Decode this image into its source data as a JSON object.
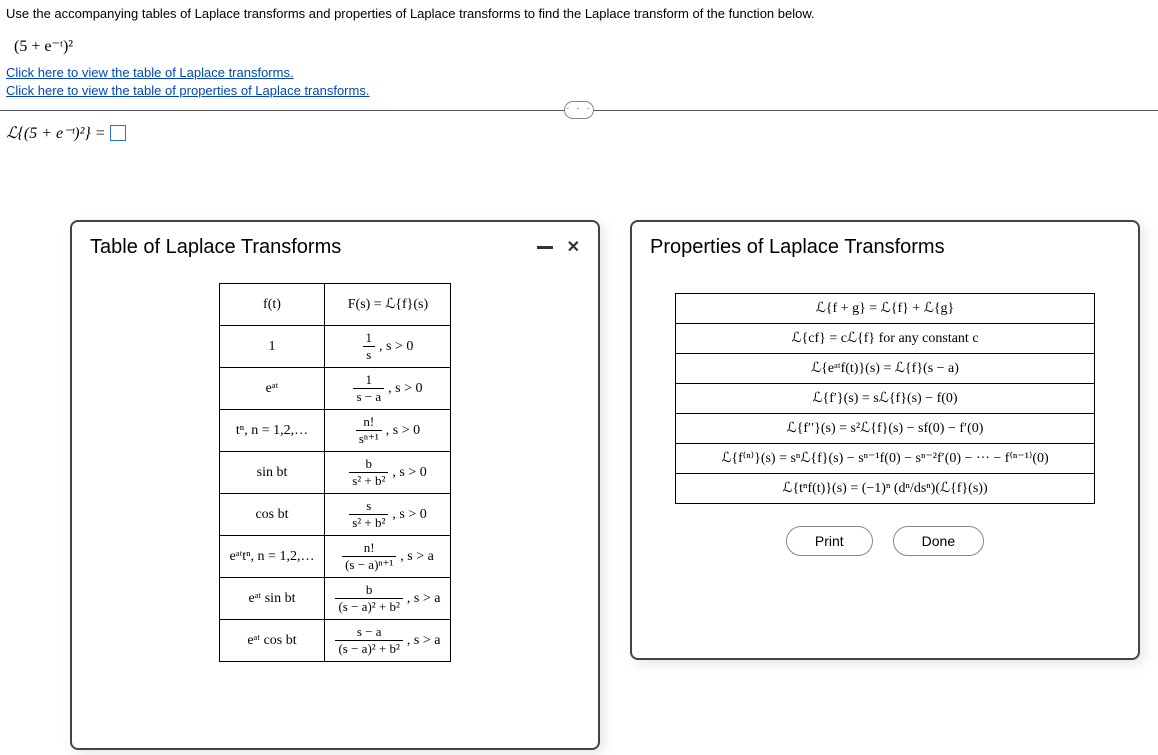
{
  "instruction": "Use the accompanying tables of Laplace transforms and properties of Laplace transforms to find the Laplace transform of the function below.",
  "expression_img": "(5 + e⁻ᵗ)²",
  "links": {
    "transforms": "Click here to view the table of Laplace transforms.",
    "properties": "Click here to view the table of properties of Laplace transforms."
  },
  "prompt": {
    "lhs": "ℒ{(5 + e⁻ᵗ)²} ="
  },
  "ellipsis": "· · ·",
  "left_panel": {
    "title": "Table of Laplace Transforms",
    "head_ft": "f(t)",
    "head_Fs": "F(s) = ℒ{f}(s)",
    "rows": [
      {
        "ft": "1",
        "num": "1",
        "den": "s",
        "cond": ", s > 0"
      },
      {
        "ft": "eᵃᵗ",
        "num": "1",
        "den": "s − a",
        "cond": ", s > 0"
      },
      {
        "ft": "tⁿ, n = 1,2,…",
        "num": "n!",
        "den": "sⁿ⁺¹",
        "cond": ", s > 0"
      },
      {
        "ft": "sin bt",
        "num": "b",
        "den": "s² + b²",
        "cond": ", s > 0"
      },
      {
        "ft": "cos bt",
        "num": "s",
        "den": "s² + b²",
        "cond": ", s > 0"
      },
      {
        "ft": "eᵃᵗtⁿ, n = 1,2,…",
        "num": "n!",
        "den": "(s − a)ⁿ⁺¹",
        "cond": ", s > a"
      },
      {
        "ft": "eᵃᵗ sin bt",
        "num": "b",
        "den": "(s − a)² + b²",
        "cond": ", s > a"
      },
      {
        "ft": "eᵃᵗ cos bt",
        "num": "s − a",
        "den": "(s − a)² + b²",
        "cond": ", s > a"
      }
    ]
  },
  "right_panel": {
    "title": "Properties of Laplace Transforms",
    "lines": [
      "ℒ{f + g} = ℒ{f} + ℒ{g}",
      "ℒ{cf} = cℒ{f} for any constant c",
      "ℒ{eᵃᵗf(t)}(s) = ℒ{f}(s − a)",
      "ℒ{f′}(s) = sℒ{f}(s) − f(0)",
      "ℒ{f′′}(s) = s²ℒ{f}(s) − sf(0) − f′(0)",
      "ℒ{f⁽ⁿ⁾}(s) = sⁿℒ{f}(s) − sⁿ⁻¹f(0) − sⁿ⁻²f′(0) − ··· − f⁽ⁿ⁻¹⁾(0)",
      "ℒ{tⁿf(t)}(s) = (−1)ⁿ (dⁿ/dsⁿ)(ℒ{f}(s))"
    ],
    "buttons": {
      "print": "Print",
      "done": "Done"
    }
  }
}
